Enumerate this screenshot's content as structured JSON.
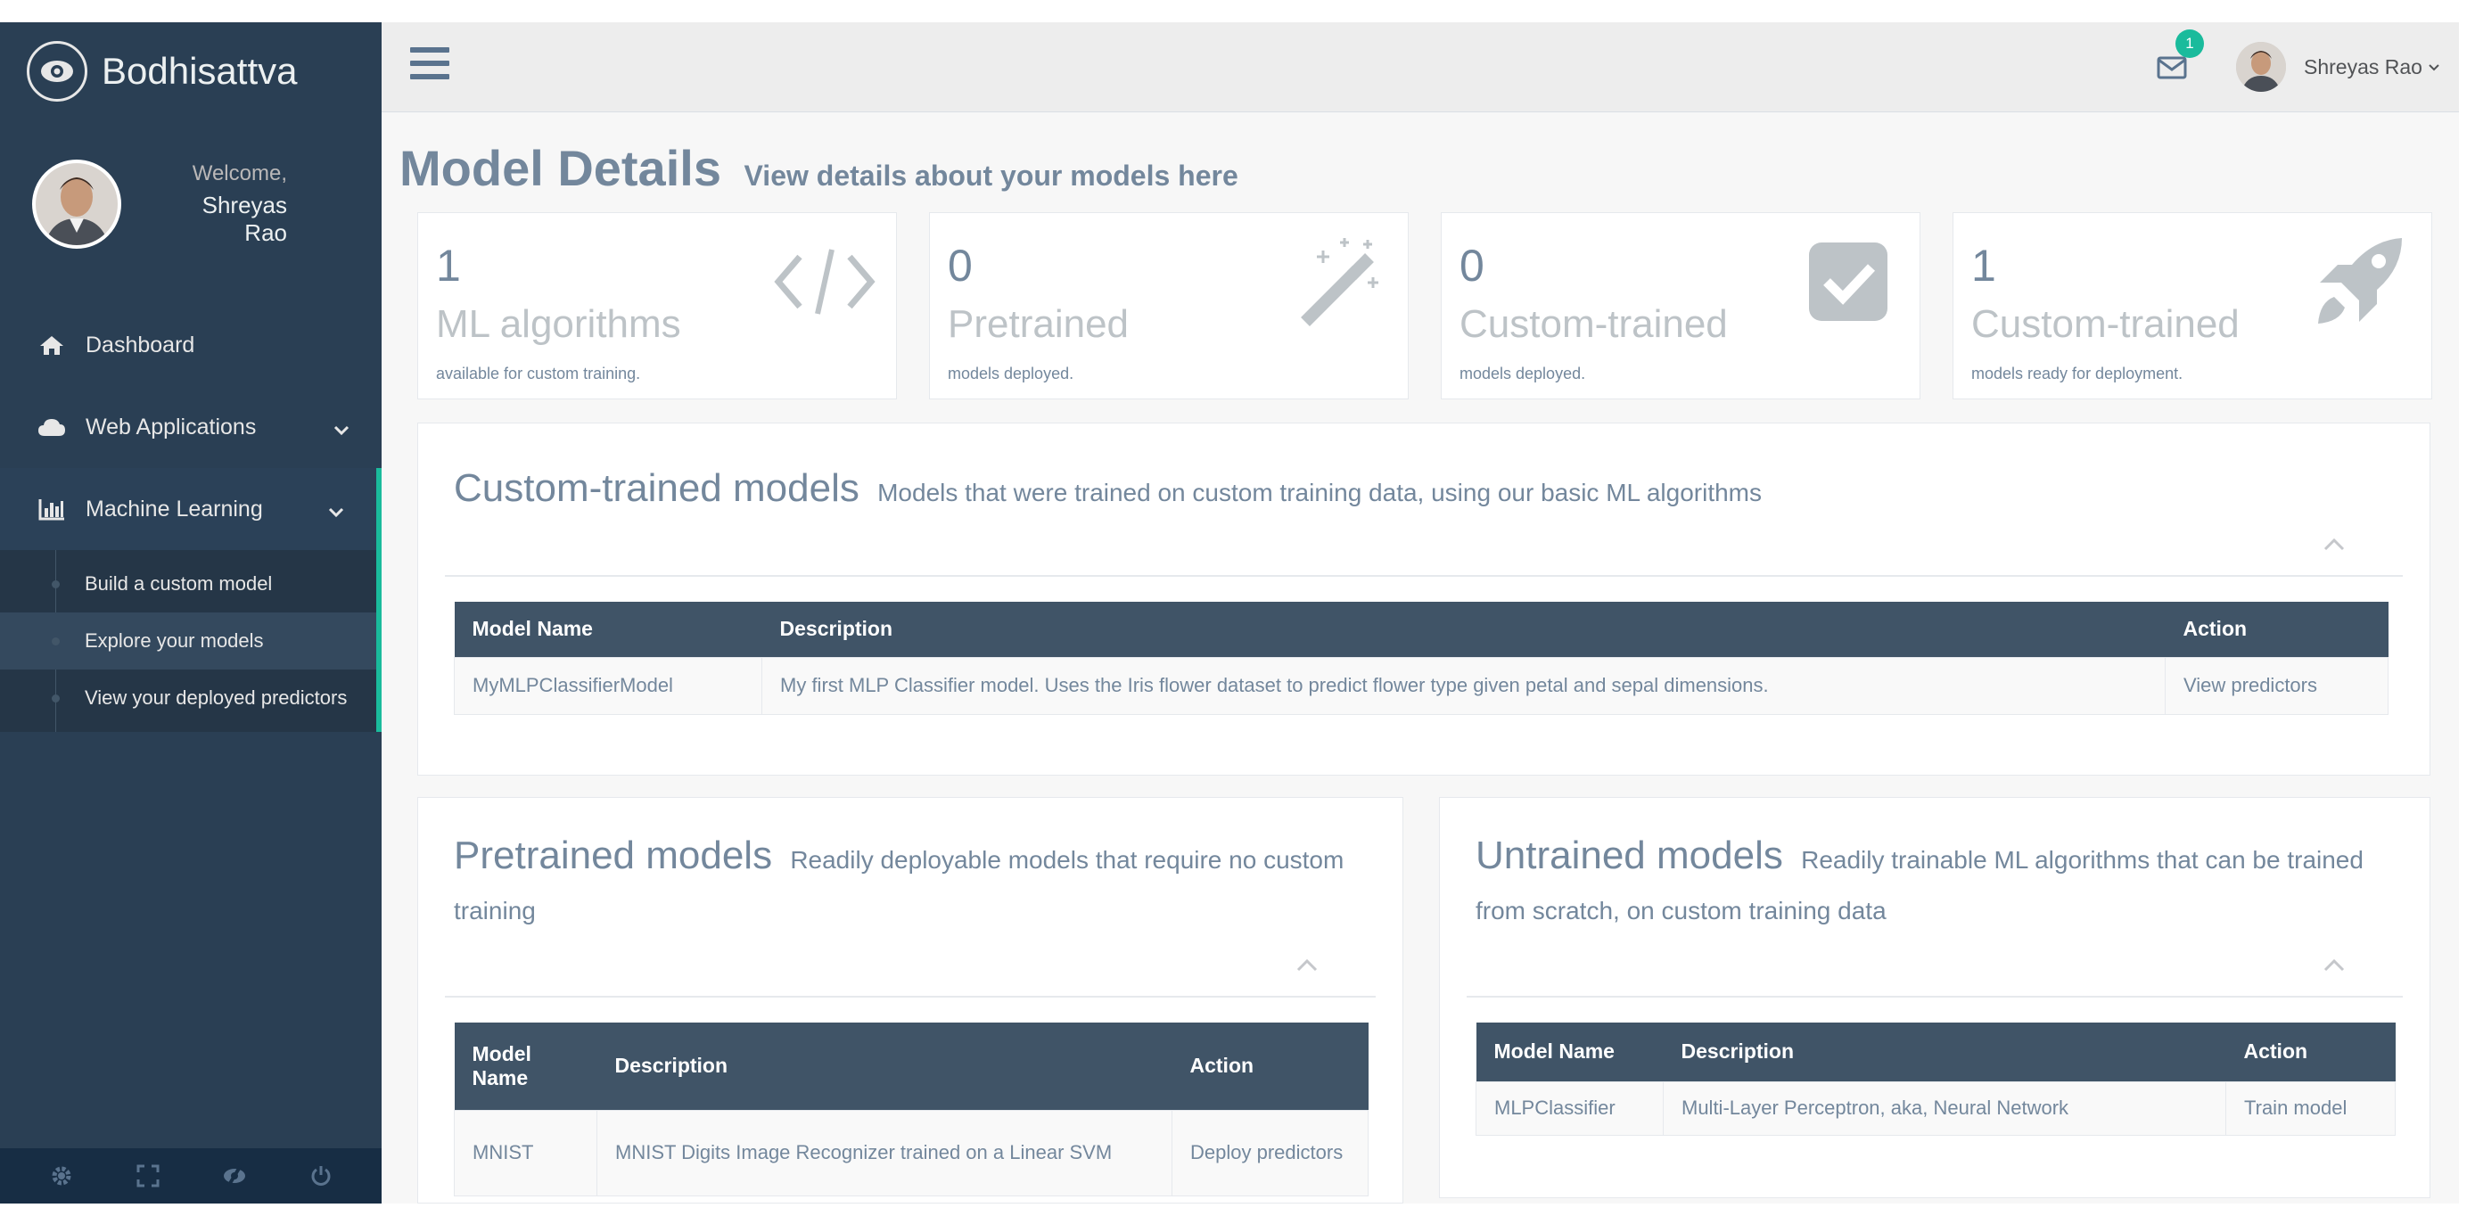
{
  "brand": {
    "name": "Bodhisattva",
    "icon": "eye-icon"
  },
  "profile": {
    "welcome": "Welcome,",
    "name": "Shreyas Rao"
  },
  "sidebar": {
    "items": [
      {
        "label": "Dashboard",
        "icon": "home-icon"
      },
      {
        "label": "Web Applications",
        "icon": "cloud-icon"
      },
      {
        "label": "Machine Learning",
        "icon": "bar-chart-icon"
      }
    ],
    "subitems": [
      {
        "label": "Build a custom model"
      },
      {
        "label": "Explore your models"
      },
      {
        "label": "View your deployed predictors"
      }
    ],
    "footer_icons": [
      "gear-icon",
      "fullscreen-icon",
      "eye-slash-icon",
      "power-icon"
    ]
  },
  "topbar": {
    "notification_count": "1",
    "user_name": "Shreyas Rao"
  },
  "page": {
    "title": "Model Details",
    "subtitle": "View details about your models here"
  },
  "tiles": [
    {
      "count": "1",
      "label": "ML algorithms",
      "sub": "available for custom training.",
      "icon": "code-icon"
    },
    {
      "count": "0",
      "label": "Pretrained",
      "sub": "models deployed.",
      "icon": "magic-wand-icon"
    },
    {
      "count": "0",
      "label": "Custom-trained",
      "sub": "models deployed.",
      "icon": "check-square-icon"
    },
    {
      "count": "1",
      "label": "Custom-trained",
      "sub": "models ready for deployment.",
      "icon": "rocket-icon"
    }
  ],
  "custom_panel": {
    "title": "Custom-trained models",
    "subtitle": "Models that were trained on custom training data, using our basic ML algorithms",
    "headers": [
      "Model Name",
      "Description",
      "Action"
    ],
    "rows": [
      {
        "name": "MyMLPClassifierModel",
        "description": "My first MLP Classifier model. Uses the Iris flower dataset to predict flower type given petal and sepal dimensions.",
        "action": "View predictors"
      }
    ]
  },
  "pretrained_panel": {
    "title": "Pretrained models",
    "subtitle": "Readily deployable models that require no custom training",
    "headers": [
      "Model Name",
      "Description",
      "Action"
    ],
    "rows": [
      {
        "name": "MNIST",
        "description": "MNIST Digits Image Recognizer trained on a Linear SVM",
        "action": "Deploy predictors"
      }
    ]
  },
  "untrained_panel": {
    "title": "Untrained models",
    "subtitle": "Readily trainable ML algorithms that can be trained from scratch, on custom training data",
    "headers": [
      "Model Name",
      "Description",
      "Action"
    ],
    "rows": [
      {
        "name": "MLPClassifier",
        "description": "Multi-Layer Perceptron, aka, Neural Network",
        "action": "Train model"
      }
    ]
  },
  "colors": {
    "sidebar": "#2a3f54",
    "accent": "#1abb9c",
    "table_header": "#405467",
    "text": "#73879c"
  }
}
